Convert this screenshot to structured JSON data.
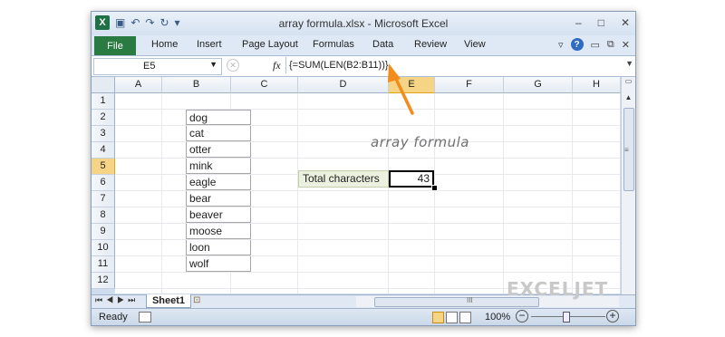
{
  "window": {
    "title": "array formula.xlsx - Microsoft Excel",
    "qat_icon": "X",
    "controls": [
      "–",
      "□",
      "✕"
    ]
  },
  "ribbon": {
    "file": "File",
    "tabs": [
      "Home",
      "Insert",
      "Page Layout",
      "Formulas",
      "Data",
      "Review",
      "View"
    ],
    "help": "?"
  },
  "formula_bar": {
    "name_box": "E5",
    "fx": "fx",
    "formula": "{=SUM(LEN(B2:B11))}"
  },
  "columns": [
    "A",
    "B",
    "C",
    "D",
    "E",
    "F",
    "G",
    "H"
  ],
  "rows": [
    "1",
    "2",
    "3",
    "4",
    "5",
    "6",
    "7",
    "8",
    "9",
    "10",
    "11",
    "12"
  ],
  "cells": {
    "b_values": [
      "dog",
      "cat",
      "otter",
      "mink",
      "eagle",
      "bear",
      "beaver",
      "moose",
      "loon",
      "wolf"
    ],
    "d5_label": "Total characters",
    "e5_value": "43"
  },
  "annotation": "array formula",
  "sheet_tab": "Sheet1",
  "status": {
    "ready": "Ready",
    "zoom": "100%"
  },
  "watermark": "EXCELJET",
  "colors": {
    "selected_header": "#f6d486",
    "label_fill": "#ebf1de",
    "arrow": "#f28c1b",
    "file_tab": "#2a7b42"
  }
}
